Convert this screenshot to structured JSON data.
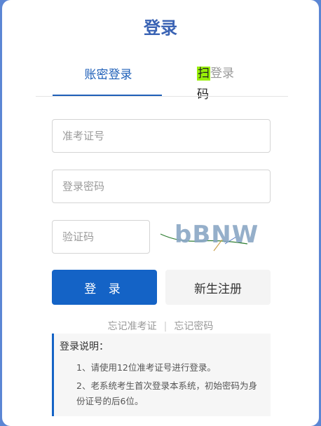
{
  "login": {
    "title": "登录",
    "tabs": {
      "account": "账密登录",
      "qr_highlight": "扫",
      "qr_rest": "登录",
      "qr_wrap": "码"
    },
    "fields": {
      "exam_id_placeholder": "准考证号",
      "password_placeholder": "登录密码",
      "captcha_placeholder": "验证码"
    },
    "captcha_text": "bBNW",
    "buttons": {
      "login": "登 录",
      "register": "新生注册"
    },
    "links": {
      "forgot_id": "忘记准考证",
      "separator": "|",
      "forgot_password": "忘记密码"
    },
    "notice": {
      "title": "登录说明：",
      "items": [
        "1、请使用12位准考证号进行登录。",
        "2、老系统考生首次登录本系统，初始密码为身份证号的后6位。"
      ]
    }
  },
  "colors": {
    "brand": "#1463c6",
    "title": "#3a63b4",
    "qr_highlight": "#98ef08",
    "page_background": "#5b86d4"
  }
}
